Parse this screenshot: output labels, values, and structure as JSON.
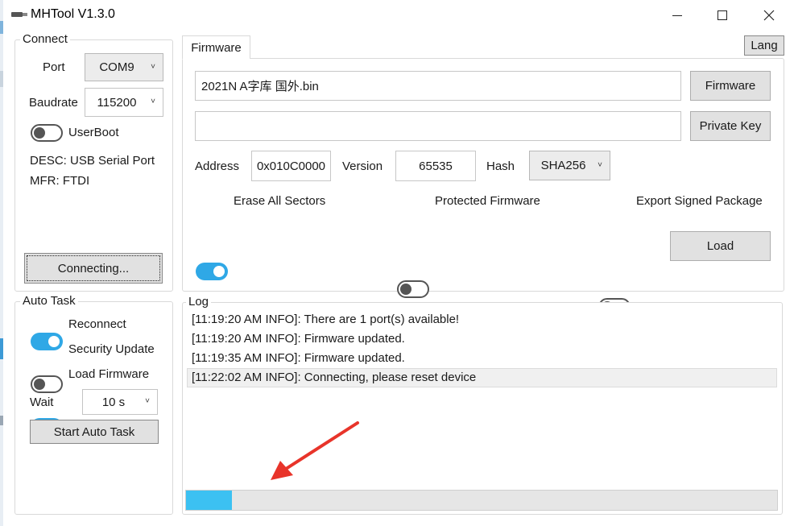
{
  "window": {
    "title": "MHTool V1.3.0",
    "controls": {
      "minimize": "—",
      "maximize": "☐",
      "close": "✕"
    }
  },
  "connect": {
    "legend": "Connect",
    "port_label": "Port",
    "port_value": "COM9",
    "baud_label": "Baudrate",
    "baud_value": "115200",
    "userboot_label": "UserBoot",
    "userboot_on": false,
    "desc": "DESC: USB Serial Port",
    "mfr": "MFR: FTDI",
    "connect_button": "Connecting..."
  },
  "auto_task": {
    "legend": "Auto Task",
    "reconnect_label": "Reconnect",
    "reconnect_on": true,
    "security_update_label": "Security Update",
    "security_update_on": false,
    "load_firmware_label": "Load Firmware",
    "load_firmware_on": true,
    "wait_label": "Wait",
    "wait_value": "10 s",
    "start_button": "Start Auto Task"
  },
  "firmware": {
    "tab_label": "Firmware",
    "lang_button": "Lang",
    "firmware_path": "2021N A字库 国外.bin",
    "firmware_button": "Firmware",
    "private_key_path": "",
    "private_key_button": "Private Key",
    "address_label": "Address",
    "address_value": "0x010C0000",
    "version_label": "Version",
    "version_value": "65535",
    "hash_label": "Hash",
    "hash_value": "SHA256",
    "erase_label": "Erase All Sectors",
    "erase_on": true,
    "protected_label": "Protected Firmware",
    "protected_on": false,
    "export_label": "Export Signed Package",
    "export_on": false,
    "load_button": "Load"
  },
  "log": {
    "legend": "Log",
    "lines": [
      "[11:19:20 AM INFO]: There are 1 port(s) available!",
      "[11:19:20 AM INFO]: Firmware updated.",
      "[11:19:35 AM INFO]: Firmware updated.",
      "[11:22:02 AM INFO]: Connecting, please reset device"
    ],
    "progress_fraction": 0.077
  },
  "colors": {
    "accent": "#2fa8e6",
    "progress_fill": "#3cc1f2",
    "progress_track": "#e6e6e6",
    "arrow": "#e8342a"
  },
  "icons": {
    "app": "usb-stick-icon",
    "dropdown": "chevron-down-icon"
  }
}
